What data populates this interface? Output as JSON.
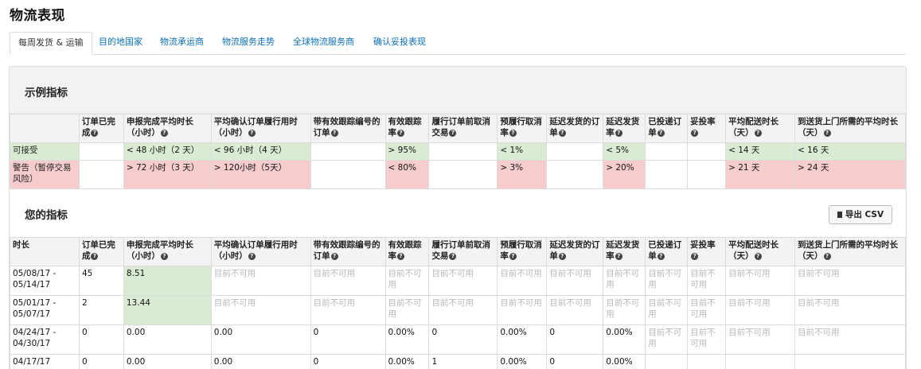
{
  "page_title": "物流表现",
  "tabs": [
    "每周发货 & 运输",
    "目的地国家",
    "物流承运商",
    "物流服务走势",
    "全球物流服务商",
    "确认妥投表现"
  ],
  "example": {
    "title": "示例指标",
    "headers": [
      "",
      "订单已完成",
      "申报完成平均时长（小时）",
      "平均确认订单履行用时（小时）",
      "带有效跟踪编号的订单",
      "有效跟踪率",
      "履行订单前取消交易",
      "预履行取消率",
      "延迟发货的订单",
      "延迟发货率",
      "已投递订单",
      "妥投率",
      "平均配送时长（天）",
      "到送货上门所需的平均时长（天）"
    ],
    "rows": [
      [
        "可接受",
        "",
        "< 48 小时（2 天）",
        "< 96 小时（4 天）",
        "",
        "> 95%",
        "",
        "< 1%",
        "",
        "< 5%",
        "",
        "",
        "< 14 天",
        "< 16 天"
      ],
      [
        "警告（暂停交易风险）",
        "",
        "> 72 小时（3 天）",
        "> 120小时（5天）",
        "",
        "< 80%",
        "",
        "> 3%",
        "",
        "> 20%",
        "",
        "",
        "> 21 天",
        "> 24 天"
      ]
    ]
  },
  "yours": {
    "title": "您的指标",
    "export_label": "导出 CSV",
    "time_header": "时长",
    "rows": [
      [
        "05/08/17 - 05/14/17",
        "45",
        "8.51",
        "目前不可用",
        "目前不可用",
        "目前不可用",
        "目前不可用",
        "目前不可用",
        "目前不可用",
        "目前不可用",
        "目前不可用",
        "目前不可用",
        "目前不可用",
        "目前不可用"
      ],
      [
        "05/01/17 - 05/07/17",
        "2",
        "13.44",
        "目前不可用",
        "目前不可用",
        "目前不可用",
        "目前不可用",
        "目前不可用",
        "目前不可用",
        "目前不可用",
        "目前不可用",
        "目前不可用",
        "目前不可用",
        "目前不可用"
      ],
      [
        "04/24/17 - 04/30/17",
        "0",
        "0.00",
        "0.00",
        "0",
        "0.00%",
        "0",
        "0.00%",
        "0",
        "0.00%",
        "目前不可用",
        "目前不可用",
        "目前不可用",
        "目前不可用"
      ],
      [
        "04/17/17",
        "0",
        "0.00",
        "0.00",
        "0",
        "0.00%",
        "1",
        "0.00%",
        "0",
        "0.00%",
        "",
        "",
        "",
        ""
      ]
    ]
  }
}
